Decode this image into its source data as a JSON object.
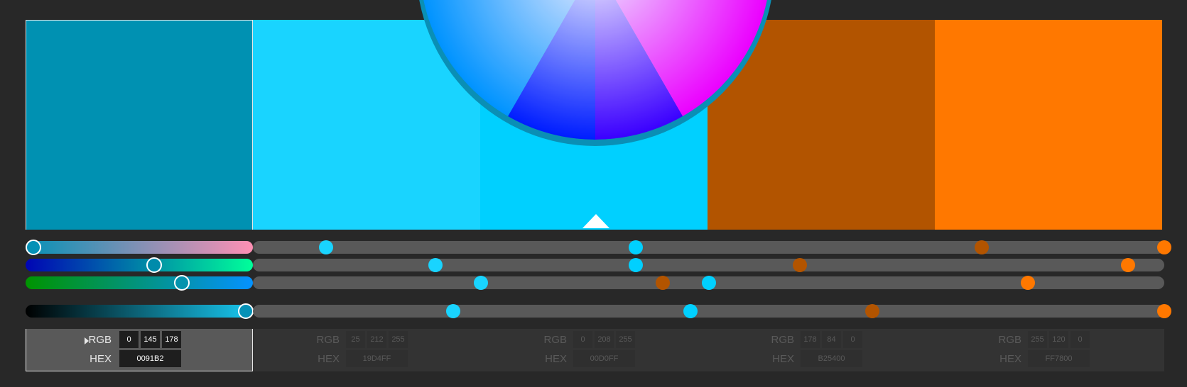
{
  "swatches": [
    {
      "name": "swatch-1",
      "color": "#0091B2",
      "selected": true,
      "r": "0",
      "g": "145",
      "b": "178",
      "hex": "0091B2"
    },
    {
      "name": "swatch-2",
      "color": "#19D4FF",
      "selected": false,
      "r": "25",
      "g": "212",
      "b": "255",
      "hex": "19D4FF"
    },
    {
      "name": "swatch-3",
      "color": "#00D0FF",
      "selected": false,
      "r": "0",
      "g": "208",
      "b": "255",
      "hex": "00D0FF"
    },
    {
      "name": "swatch-4",
      "color": "#B25400",
      "selected": false,
      "r": "178",
      "g": "84",
      "b": "0",
      "hex": "B25400"
    },
    {
      "name": "swatch-5",
      "color": "#FF7800",
      "selected": false,
      "r": "255",
      "g": "120",
      "b": "0",
      "hex": "FF7800"
    }
  ],
  "labels": {
    "rgb": "RGB",
    "hex": "HEX"
  },
  "slider_rows": [
    {
      "name": "red-slider",
      "dots": [
        0.08,
        0.42,
        0.8,
        1.0
      ]
    },
    {
      "name": "green-slider",
      "dots": [
        0.2,
        0.42,
        0.6,
        0.96
      ]
    },
    {
      "name": "blue-slider",
      "dots": [
        0.25,
        0.5,
        0.45,
        0.85
      ]
    },
    {
      "name": "brightness-slider",
      "dots": [
        0.22,
        0.48,
        0.68,
        1.0
      ]
    }
  ]
}
